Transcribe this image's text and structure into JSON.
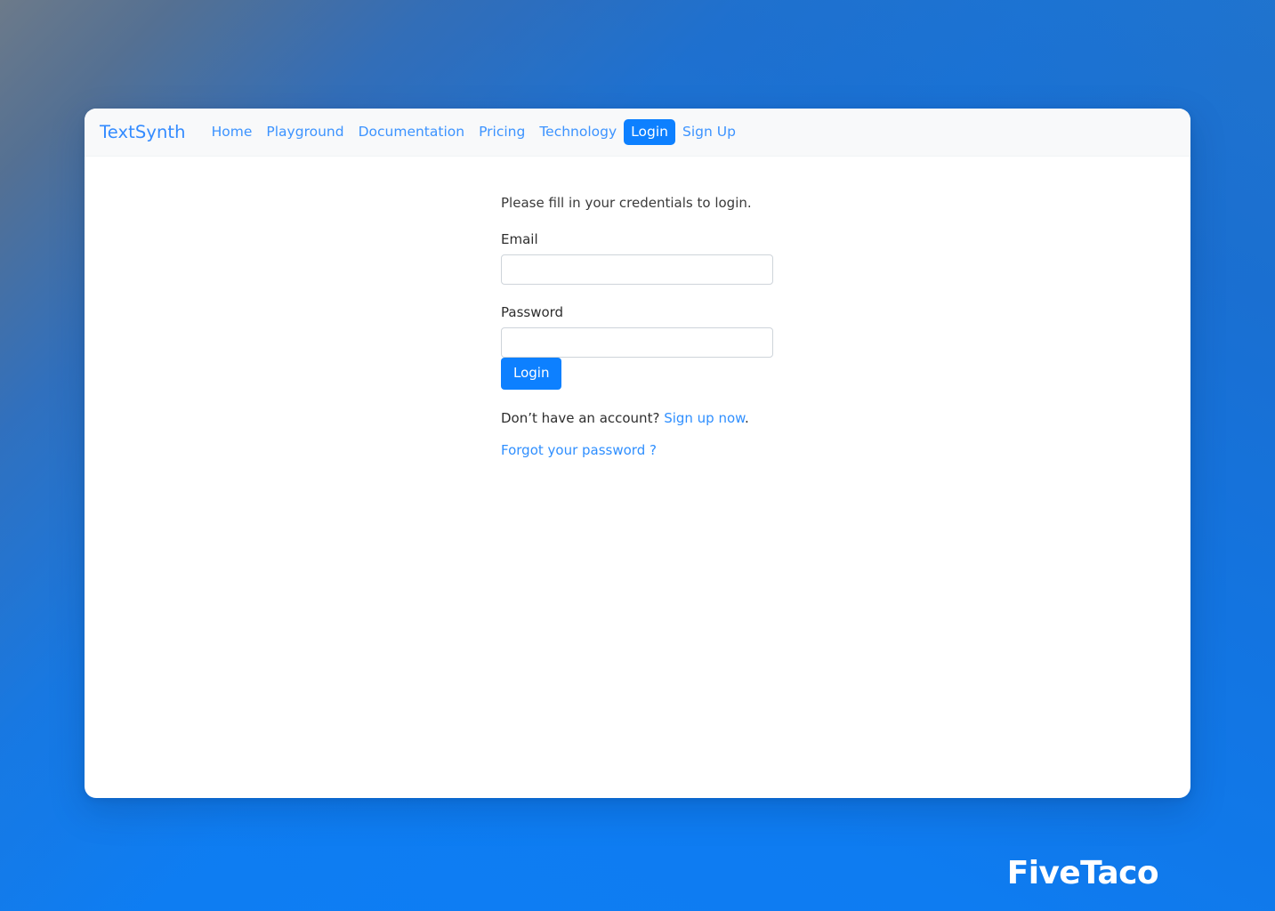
{
  "background": {
    "accent_blue": "#0d7ef5",
    "muted_top_left": "#6c7a8a"
  },
  "navbar": {
    "brand": "TextSynth",
    "items": [
      {
        "label": "Home",
        "active": false
      },
      {
        "label": "Playground",
        "active": false
      },
      {
        "label": "Documentation",
        "active": false
      },
      {
        "label": "Pricing",
        "active": false
      },
      {
        "label": "Technology",
        "active": false
      },
      {
        "label": "Login",
        "active": true
      },
      {
        "label": "Sign Up",
        "active": false
      }
    ],
    "active_bg": "#0d80ff",
    "link_color": "#3c93ff",
    "bar_bg": "#f8f9fa"
  },
  "login_form": {
    "intro": "Please fill in your credentials to login.",
    "email_label": "Email",
    "email_value": "",
    "email_placeholder": "",
    "password_label": "Password",
    "password_value": "",
    "password_placeholder": "",
    "submit_label": "Login",
    "signup_prompt": "Don’t have an account? ",
    "signup_link": "Sign up now",
    "signup_suffix": ".",
    "forgot_link": "Forgot your password ?"
  },
  "watermark": {
    "text": "FiveTaco"
  }
}
